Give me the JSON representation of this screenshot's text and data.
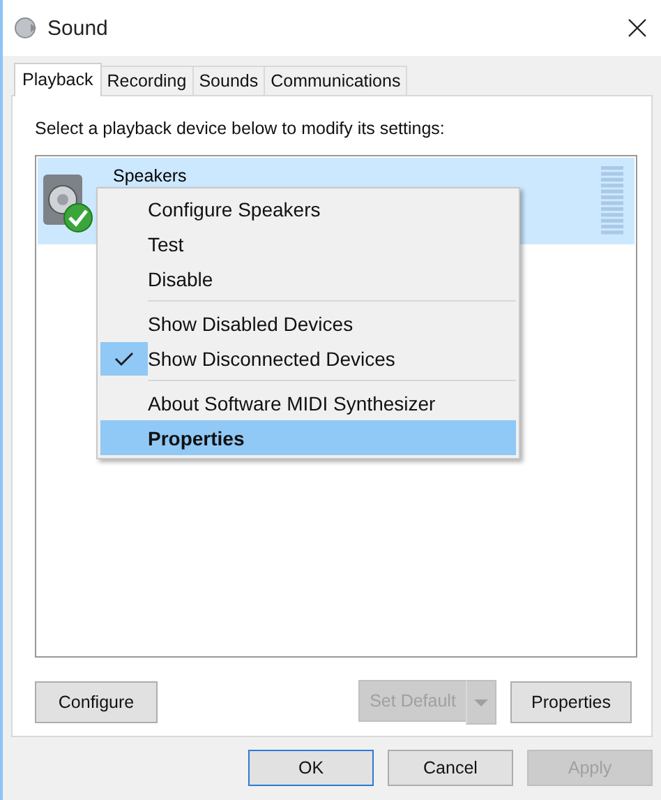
{
  "window": {
    "title": "Sound"
  },
  "tabs": [
    {
      "label": "Playback",
      "selected": true
    },
    {
      "label": "Recording",
      "selected": false
    },
    {
      "label": "Sounds",
      "selected": false
    },
    {
      "label": "Communications",
      "selected": false
    }
  ],
  "instruction": "Select a playback device below to modify its settings:",
  "devices": [
    {
      "name": "Speakers",
      "selected": true,
      "is_default": true
    }
  ],
  "context_menu": [
    {
      "kind": "item",
      "label": "Configure Speakers",
      "checked": false,
      "selected": false,
      "default": false
    },
    {
      "kind": "item",
      "label": "Test",
      "checked": false,
      "selected": false,
      "default": false
    },
    {
      "kind": "item",
      "label": "Disable",
      "checked": false,
      "selected": false,
      "default": false
    },
    {
      "kind": "separator"
    },
    {
      "kind": "item",
      "label": "Show Disabled Devices",
      "checked": false,
      "selected": false,
      "default": false
    },
    {
      "kind": "item",
      "label": "Show Disconnected Devices",
      "checked": true,
      "selected": false,
      "default": false
    },
    {
      "kind": "separator"
    },
    {
      "kind": "item",
      "label": "About Software MIDI Synthesizer",
      "checked": false,
      "selected": false,
      "default": false
    },
    {
      "kind": "item",
      "label": "Properties",
      "checked": false,
      "selected": true,
      "default": true
    }
  ],
  "panel_buttons": [
    {
      "kind": "button",
      "label": "Configure",
      "disabled": false
    },
    {
      "kind": "split",
      "label": "Set Default",
      "disabled": true
    },
    {
      "kind": "button",
      "label": "Properties",
      "disabled": false
    }
  ],
  "dialog_buttons": [
    {
      "label": "OK",
      "disabled": false,
      "focused": true
    },
    {
      "label": "Cancel",
      "disabled": false,
      "focused": false
    },
    {
      "label": "Apply",
      "disabled": true,
      "focused": false
    }
  ]
}
